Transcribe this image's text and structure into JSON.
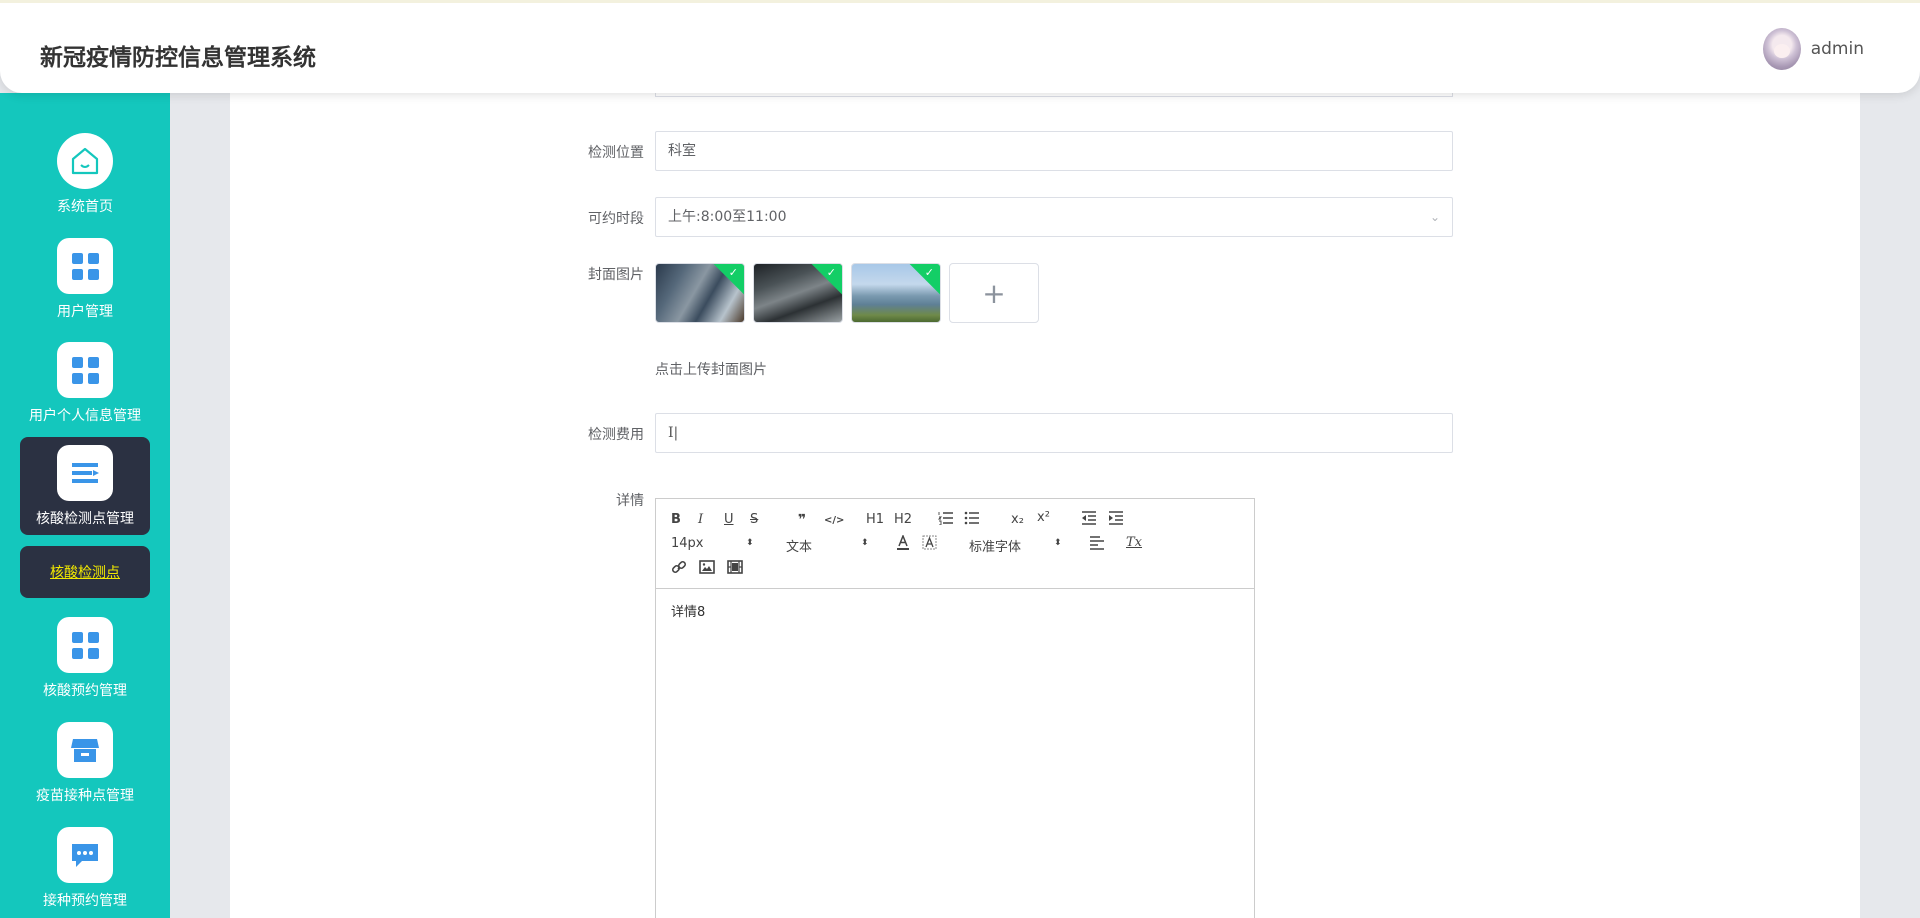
{
  "header": {
    "title": "新冠疫情防控信息管理系统",
    "username": "admin"
  },
  "sidebar": {
    "items": [
      {
        "label": "系统首页",
        "icon": "home-icon"
      },
      {
        "label": "用户管理",
        "icon": "grid-icon"
      },
      {
        "label": "用户个人信息管理",
        "icon": "grid-icon"
      },
      {
        "label": "核酸检测点管理",
        "icon": "list-icon"
      },
      {
        "label": "核酸预约管理",
        "icon": "grid-icon"
      },
      {
        "label": "疫苗接种点管理",
        "icon": "store-icon"
      },
      {
        "label": "接种预约管理",
        "icon": "chat-icon"
      }
    ],
    "submenu_label": "核酸检测点"
  },
  "form": {
    "location_label": "检测位置",
    "location_value": "科室",
    "timeslot_label": "可约时段",
    "timeslot_value": "上午:8:00至11:00",
    "cover_label": "封面图片",
    "cover_tip": "点击上传封面图片",
    "fee_label": "检测费用",
    "fee_value": "I|",
    "detail_label": "详情"
  },
  "editor": {
    "toolbar": {
      "bold": "B",
      "italic": "I",
      "underline": "U",
      "strike": "S",
      "quote": "❞",
      "code": "</>",
      "h1": "H1",
      "h2": "H2",
      "subscript": "x₂",
      "superscript": "x²",
      "font_size": "14px",
      "text_type": "文本",
      "font_family": "标准字体",
      "clear_format": "Tx"
    },
    "content": "详情8"
  },
  "colors": {
    "sidebar": "#14c7bd",
    "active": "#2b3142",
    "submenu_text": "#f2e900",
    "icon_blue": "#3a95e8"
  }
}
